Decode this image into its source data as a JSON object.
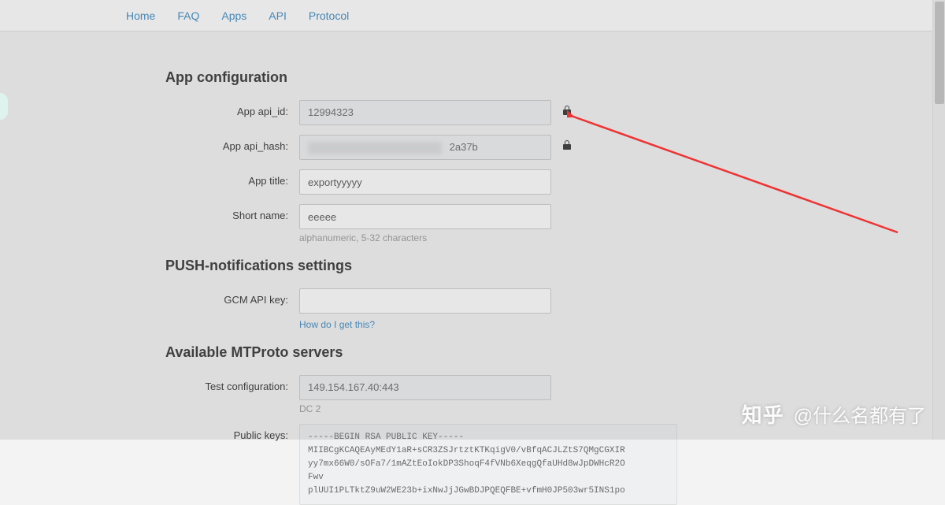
{
  "nav": {
    "items": [
      "Home",
      "FAQ",
      "Apps",
      "API",
      "Protocol"
    ]
  },
  "sections": {
    "app_config": {
      "heading": "App configuration",
      "api_id_label": "App api_id:",
      "api_id_value": "12994323",
      "api_hash_label": "App api_hash:",
      "api_hash_visible_suffix": "2a37b",
      "app_title_label": "App title:",
      "app_title_value": "exportyyyyy",
      "short_name_label": "Short name:",
      "short_name_value": "eeeee",
      "short_name_hint": "alphanumeric, 5-32 characters"
    },
    "push": {
      "heading": "PUSH-notifications settings",
      "gcm_label": "GCM API key:",
      "gcm_value": "",
      "help_link": "How do I get this?"
    },
    "mtproto": {
      "heading": "Available MTProto servers",
      "test_cfg_label": "Test configuration:",
      "test_cfg_value": "149.154.167.40:443",
      "test_cfg_hint": "DC 2",
      "public_keys_label": "Public keys:",
      "public_keys_value": "-----BEGIN RSA PUBLIC KEY-----\nMIIBCgKCAQEAyMEdY1aR+sCR3ZSJrtztKTKqigV0/vBfqACJLZtS7QMgCGXIR\nyy7mx66W0/sOFa7/1mAZtEoIokDP3ShoqF4fVNb6XeqgQfaUHd8wJpDWHcR2O\nFwv\nplUUI1PLTktZ9uW2WE23b+ixNwJjJGwBDJPQEQFBE+vfmH0JP503wr5INS1po"
    }
  },
  "watermark": {
    "logo": "知乎",
    "text": "@什么名都有了"
  }
}
